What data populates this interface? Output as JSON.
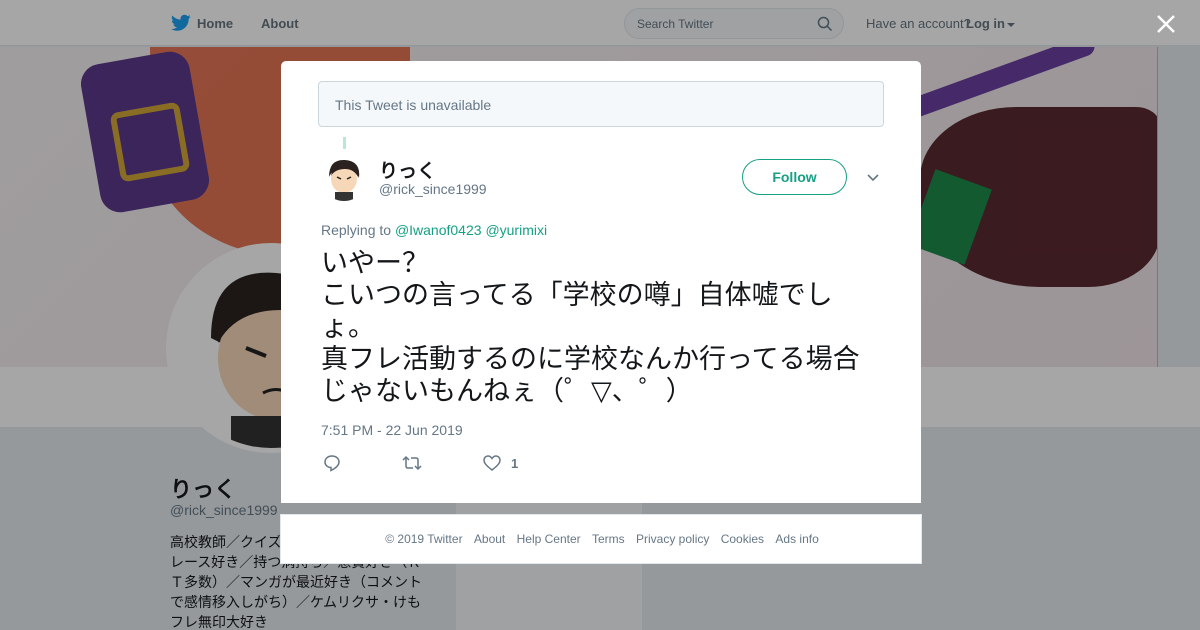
{
  "topbar": {
    "home": "Home",
    "about": "About",
    "search_placeholder": "Search Twitter",
    "have_account": "Have an account?",
    "login": "Log in"
  },
  "profile": {
    "name": "りっく",
    "handle": "@rick_since1999",
    "bio": "高校教師／クイズ／競馬・競輪・オートレース好き／持つ病持ち／懸賞好き（ＲＴ多数）／マンガが最近好き（コメントで感情移入しがち）／ケムリクサ・けもフレ無印大好き"
  },
  "modal": {
    "unavailable": "This Tweet is unavailable",
    "tweet": {
      "name": "りっく",
      "handle": "@rick_since1999",
      "follow_label": "Follow",
      "replying_to": "Replying to",
      "mention_1": "@Iwanof0423",
      "mention_2": "@yurimixi",
      "text_lines": [
        "いやー？",
        "こいつの言ってる「学校の噂」自体嘘でし",
        "ょ。",
        "真フレ活動するのに学校なんか行ってる場合",
        "じゃないもんねぇ（゜▽、゜）"
      ],
      "timestamp": "7:51 PM - 22 Jun 2019",
      "like_count": "1"
    }
  },
  "footer": {
    "links": [
      "© 2019 Twitter",
      "About",
      "Help Center",
      "Terms",
      "Privacy policy",
      "Cookies",
      "Ads info"
    ]
  },
  "colors": {
    "accent": "#16a085",
    "twitter_blue": "#1da1f2",
    "muted": "#657786"
  },
  "icons": [
    "twitter-bird-icon",
    "search-icon",
    "close-icon",
    "chevron-down-icon",
    "reply-icon",
    "retweet-icon",
    "heart-icon"
  ]
}
